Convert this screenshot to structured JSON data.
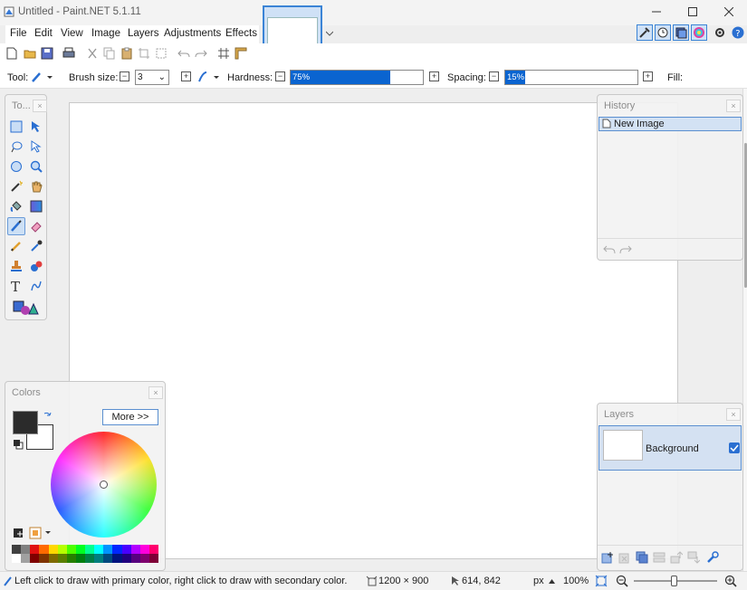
{
  "window": {
    "title": "Untitled - Paint.NET 5.1.11"
  },
  "menu": [
    "File",
    "Edit",
    "View",
    "Image",
    "Layers",
    "Adjustments",
    "Effects"
  ],
  "options": {
    "tool_label": "Tool:",
    "brush_size_label": "Brush size:",
    "brush_size_value": "3",
    "hardness_label": "Hardness:",
    "hardness_value": "75%",
    "hardness_fraction": 0.75,
    "spacing_label": "Spacing:",
    "spacing_value": "15%",
    "spacing_fraction": 0.15,
    "fill_label": "Fill:"
  },
  "panels": {
    "tools_title": "To...",
    "history_title": "History",
    "history_items": [
      "New Image"
    ],
    "colors_title": "Colors",
    "colors_more": "More >>",
    "layers_title": "Layers",
    "layers_items": [
      {
        "name": "Background",
        "visible": true
      }
    ]
  },
  "status": {
    "hint": "Left click to draw with primary color, right click to draw with secondary color.",
    "image_size": "1200 × 900",
    "cursor_pos": "614, 842",
    "units": "px",
    "zoom": "100%"
  },
  "colors": {
    "accent": "#0a64d0",
    "primary": "#2b2b2b",
    "secondary": "#ffffff",
    "selection": "#d3e2f4"
  },
  "icons": {
    "tools": [
      "rectangle-select-icon",
      "move-selection-icon",
      "lasso-select-icon",
      "move-selected-icon",
      "ellipse-select-icon",
      "zoom-icon",
      "magic-wand-icon",
      "pan-icon",
      "paint-bucket-icon",
      "gradient-icon",
      "paintbrush-icon",
      "eraser-icon",
      "pencil-icon",
      "color-picker-icon",
      "clone-stamp-icon",
      "recolor-icon",
      "text-icon",
      "line-curve-icon",
      "shapes-icon"
    ]
  }
}
